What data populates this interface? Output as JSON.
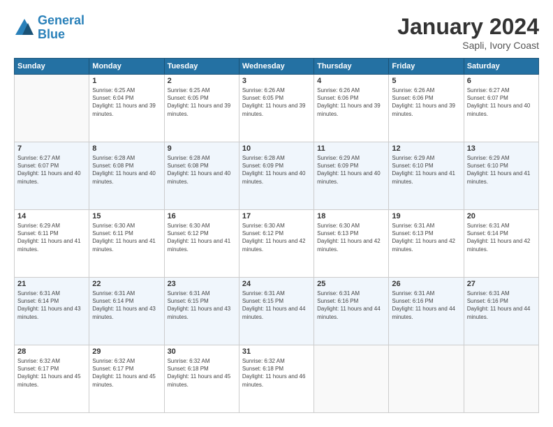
{
  "logo": {
    "line1": "General",
    "line2": "Blue"
  },
  "title": "January 2024",
  "subtitle": "Sapli, Ivory Coast",
  "days_header": [
    "Sunday",
    "Monday",
    "Tuesday",
    "Wednesday",
    "Thursday",
    "Friday",
    "Saturday"
  ],
  "weeks": [
    [
      {
        "day": "",
        "sunrise": "",
        "sunset": "",
        "daylight": ""
      },
      {
        "day": "1",
        "sunrise": "Sunrise: 6:25 AM",
        "sunset": "Sunset: 6:04 PM",
        "daylight": "Daylight: 11 hours and 39 minutes."
      },
      {
        "day": "2",
        "sunrise": "Sunrise: 6:25 AM",
        "sunset": "Sunset: 6:05 PM",
        "daylight": "Daylight: 11 hours and 39 minutes."
      },
      {
        "day": "3",
        "sunrise": "Sunrise: 6:26 AM",
        "sunset": "Sunset: 6:05 PM",
        "daylight": "Daylight: 11 hours and 39 minutes."
      },
      {
        "day": "4",
        "sunrise": "Sunrise: 6:26 AM",
        "sunset": "Sunset: 6:06 PM",
        "daylight": "Daylight: 11 hours and 39 minutes."
      },
      {
        "day": "5",
        "sunrise": "Sunrise: 6:26 AM",
        "sunset": "Sunset: 6:06 PM",
        "daylight": "Daylight: 11 hours and 39 minutes."
      },
      {
        "day": "6",
        "sunrise": "Sunrise: 6:27 AM",
        "sunset": "Sunset: 6:07 PM",
        "daylight": "Daylight: 11 hours and 40 minutes."
      }
    ],
    [
      {
        "day": "7",
        "sunrise": "Sunrise: 6:27 AM",
        "sunset": "Sunset: 6:07 PM",
        "daylight": "Daylight: 11 hours and 40 minutes."
      },
      {
        "day": "8",
        "sunrise": "Sunrise: 6:28 AM",
        "sunset": "Sunset: 6:08 PM",
        "daylight": "Daylight: 11 hours and 40 minutes."
      },
      {
        "day": "9",
        "sunrise": "Sunrise: 6:28 AM",
        "sunset": "Sunset: 6:08 PM",
        "daylight": "Daylight: 11 hours and 40 minutes."
      },
      {
        "day": "10",
        "sunrise": "Sunrise: 6:28 AM",
        "sunset": "Sunset: 6:09 PM",
        "daylight": "Daylight: 11 hours and 40 minutes."
      },
      {
        "day": "11",
        "sunrise": "Sunrise: 6:29 AM",
        "sunset": "Sunset: 6:09 PM",
        "daylight": "Daylight: 11 hours and 40 minutes."
      },
      {
        "day": "12",
        "sunrise": "Sunrise: 6:29 AM",
        "sunset": "Sunset: 6:10 PM",
        "daylight": "Daylight: 11 hours and 41 minutes."
      },
      {
        "day": "13",
        "sunrise": "Sunrise: 6:29 AM",
        "sunset": "Sunset: 6:10 PM",
        "daylight": "Daylight: 11 hours and 41 minutes."
      }
    ],
    [
      {
        "day": "14",
        "sunrise": "Sunrise: 6:29 AM",
        "sunset": "Sunset: 6:11 PM",
        "daylight": "Daylight: 11 hours and 41 minutes."
      },
      {
        "day": "15",
        "sunrise": "Sunrise: 6:30 AM",
        "sunset": "Sunset: 6:11 PM",
        "daylight": "Daylight: 11 hours and 41 minutes."
      },
      {
        "day": "16",
        "sunrise": "Sunrise: 6:30 AM",
        "sunset": "Sunset: 6:12 PM",
        "daylight": "Daylight: 11 hours and 41 minutes."
      },
      {
        "day": "17",
        "sunrise": "Sunrise: 6:30 AM",
        "sunset": "Sunset: 6:12 PM",
        "daylight": "Daylight: 11 hours and 42 minutes."
      },
      {
        "day": "18",
        "sunrise": "Sunrise: 6:30 AM",
        "sunset": "Sunset: 6:13 PM",
        "daylight": "Daylight: 11 hours and 42 minutes."
      },
      {
        "day": "19",
        "sunrise": "Sunrise: 6:31 AM",
        "sunset": "Sunset: 6:13 PM",
        "daylight": "Daylight: 11 hours and 42 minutes."
      },
      {
        "day": "20",
        "sunrise": "Sunrise: 6:31 AM",
        "sunset": "Sunset: 6:14 PM",
        "daylight": "Daylight: 11 hours and 42 minutes."
      }
    ],
    [
      {
        "day": "21",
        "sunrise": "Sunrise: 6:31 AM",
        "sunset": "Sunset: 6:14 PM",
        "daylight": "Daylight: 11 hours and 43 minutes."
      },
      {
        "day": "22",
        "sunrise": "Sunrise: 6:31 AM",
        "sunset": "Sunset: 6:14 PM",
        "daylight": "Daylight: 11 hours and 43 minutes."
      },
      {
        "day": "23",
        "sunrise": "Sunrise: 6:31 AM",
        "sunset": "Sunset: 6:15 PM",
        "daylight": "Daylight: 11 hours and 43 minutes."
      },
      {
        "day": "24",
        "sunrise": "Sunrise: 6:31 AM",
        "sunset": "Sunset: 6:15 PM",
        "daylight": "Daylight: 11 hours and 44 minutes."
      },
      {
        "day": "25",
        "sunrise": "Sunrise: 6:31 AM",
        "sunset": "Sunset: 6:16 PM",
        "daylight": "Daylight: 11 hours and 44 minutes."
      },
      {
        "day": "26",
        "sunrise": "Sunrise: 6:31 AM",
        "sunset": "Sunset: 6:16 PM",
        "daylight": "Daylight: 11 hours and 44 minutes."
      },
      {
        "day": "27",
        "sunrise": "Sunrise: 6:31 AM",
        "sunset": "Sunset: 6:16 PM",
        "daylight": "Daylight: 11 hours and 44 minutes."
      }
    ],
    [
      {
        "day": "28",
        "sunrise": "Sunrise: 6:32 AM",
        "sunset": "Sunset: 6:17 PM",
        "daylight": "Daylight: 11 hours and 45 minutes."
      },
      {
        "day": "29",
        "sunrise": "Sunrise: 6:32 AM",
        "sunset": "Sunset: 6:17 PM",
        "daylight": "Daylight: 11 hours and 45 minutes."
      },
      {
        "day": "30",
        "sunrise": "Sunrise: 6:32 AM",
        "sunset": "Sunset: 6:18 PM",
        "daylight": "Daylight: 11 hours and 45 minutes."
      },
      {
        "day": "31",
        "sunrise": "Sunrise: 6:32 AM",
        "sunset": "Sunset: 6:18 PM",
        "daylight": "Daylight: 11 hours and 46 minutes."
      },
      {
        "day": "",
        "sunrise": "",
        "sunset": "",
        "daylight": ""
      },
      {
        "day": "",
        "sunrise": "",
        "sunset": "",
        "daylight": ""
      },
      {
        "day": "",
        "sunrise": "",
        "sunset": "",
        "daylight": ""
      }
    ]
  ]
}
